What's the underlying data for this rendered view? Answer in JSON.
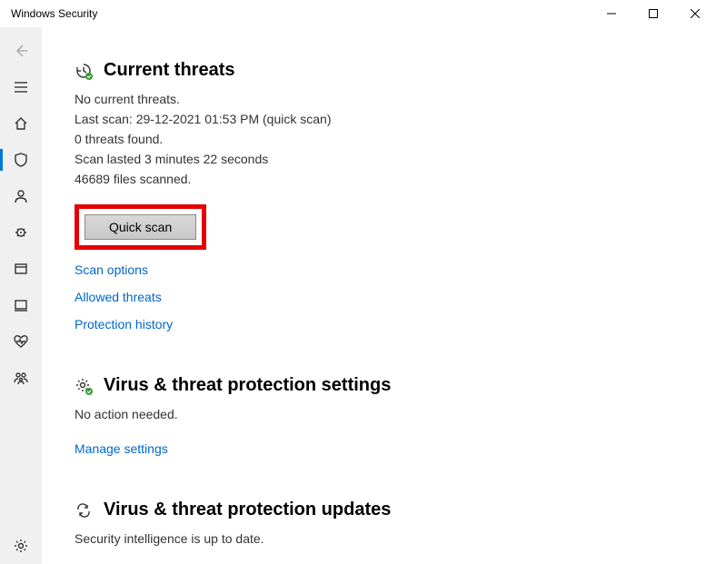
{
  "window": {
    "title": "Windows Security"
  },
  "current_threats": {
    "title": "Current threats",
    "no_threats": "No current threats.",
    "last_scan": "Last scan: 29-12-2021 01:53 PM (quick scan)",
    "threats_found": "0 threats found.",
    "duration": "Scan lasted 3 minutes 22 seconds",
    "files_scanned": "46689 files scanned.",
    "quick_scan_label": "Quick scan",
    "links": {
      "scan_options": "Scan options",
      "allowed_threats": "Allowed threats",
      "protection_history": "Protection history"
    }
  },
  "settings_section": {
    "title": "Virus & threat protection settings",
    "status": "No action needed.",
    "manage_link": "Manage settings"
  },
  "updates_section": {
    "title": "Virus & threat protection updates",
    "status": "Security intelligence is up to date."
  }
}
